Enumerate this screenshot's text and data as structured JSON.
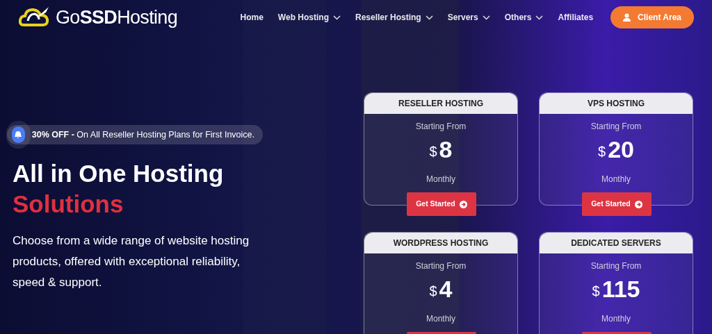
{
  "header": {
    "logo": {
      "prefix": "Go",
      "bold": "SSD",
      "suffix": "Hosting"
    },
    "nav": [
      {
        "label": "Home",
        "dropdown": false
      },
      {
        "label": "Web Hosting",
        "dropdown": true
      },
      {
        "label": "Reseller Hosting",
        "dropdown": true
      },
      {
        "label": "Servers",
        "dropdown": true
      },
      {
        "label": "Others",
        "dropdown": true
      },
      {
        "label": "Affiliates",
        "dropdown": false
      }
    ],
    "client_button": "Client Area"
  },
  "hero": {
    "promo": {
      "highlight": "30% OFF -",
      "text": "On All Reseller Hosting Plans for First Invoice."
    },
    "title": "All in One Hosting",
    "title_accent": "Solutions",
    "description": "Choose from a wide range of website hosting products, offered with exceptional reliability, speed & support."
  },
  "plans": [
    {
      "name": "RESELLER HOSTING",
      "starting": "Starting From",
      "currency": "$",
      "price": "8",
      "period": "Monthly",
      "button": {
        "kind": "full",
        "label": "Get Started"
      }
    },
    {
      "name": "VPS HOSTING",
      "starting": "Starting From",
      "currency": "$",
      "price": "20",
      "period": "Monthly",
      "button": {
        "kind": "full",
        "label": "Get Started"
      }
    },
    {
      "name": "WORDPRESS HOSTING",
      "starting": "Starting From",
      "currency": "$",
      "price": "4",
      "period": "Monthly",
      "button": {
        "kind": "cut"
      }
    },
    {
      "name": "DEDICATED SERVERS",
      "starting": "Starting From",
      "currency": "$",
      "price": "115",
      "period": "Monthly",
      "button": {
        "kind": "cut"
      }
    }
  ]
}
